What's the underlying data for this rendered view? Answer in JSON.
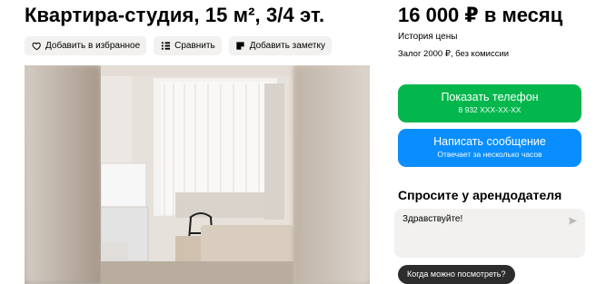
{
  "listing": {
    "title": "Квартира-студия, 15 м², 3/4 эт."
  },
  "actions": [
    {
      "label": "Добавить в избранное",
      "icon": "heart-icon"
    },
    {
      "label": "Сравнить",
      "icon": "compare-icon"
    },
    {
      "label": "Добавить заметку",
      "icon": "note-icon"
    }
  ],
  "pricing": {
    "price": "16 000 ₽ в месяц",
    "history_label": "История цены",
    "deposit": "Залог 2000 ₽, без комиссии"
  },
  "contact": {
    "phone_label": "Показать телефон",
    "phone_masked": "8 932 XXX-XX-XX",
    "message_label": "Написать сообщение",
    "message_sub": "Отвечает за несколько часов",
    "phone_color": "#04b74d",
    "message_color": "#0a8eff"
  },
  "ask": {
    "title": "Спросите у арендодателя",
    "message_value": "Здравствуйте!",
    "send_icon": "send-icon",
    "quick_question": "Когда можно посмотреть?"
  }
}
